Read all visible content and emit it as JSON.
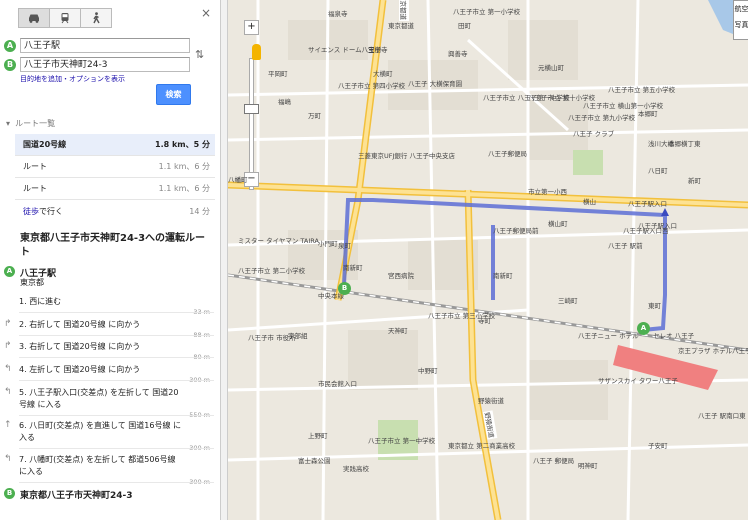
{
  "modes": [
    {
      "icon": "car-icon"
    },
    {
      "icon": "train-icon"
    },
    {
      "icon": "walk-icon"
    }
  ],
  "close": "×",
  "waypoints": [
    {
      "marker": "A",
      "value": "八王子駅"
    },
    {
      "marker": "B",
      "value": "八王子市天神町24-3"
    }
  ],
  "options_link": "目的地を追加・オプションを表示",
  "search_button": "検索",
  "routes_header": "ルート一覧",
  "routes": [
    {
      "name": "国道20号線",
      "distance": "1.8 km、5 分",
      "selected": true
    },
    {
      "name": "ルート",
      "distance": "1.1 km、6 分"
    },
    {
      "name": "ルート",
      "distance": "1.1 km、6 分"
    },
    {
      "name_link": "徒歩",
      "name_rest": "で行く",
      "distance": "14 分"
    }
  ],
  "directions_title": "東京都八王子市天神町24-3への運転ルート",
  "start": {
    "marker": "A",
    "name": "八王子駅",
    "sub": "東京都"
  },
  "steps": [
    {
      "num": "1.",
      "text": "西に進む",
      "dist": "33 m"
    },
    {
      "num": "2.",
      "text": "右折して 国道20号線 に向かう",
      "dist": "88 m"
    },
    {
      "num": "3.",
      "text": "右折して 国道20号線 に向かう",
      "dist": "80 m"
    },
    {
      "num": "4.",
      "text": "左折して 国道20号線 に向かう",
      "dist": "300 m"
    },
    {
      "num": "5.",
      "text": "八王子駅入口(交差点) を左折して 国道20号線 に入る",
      "dist": "550 m"
    },
    {
      "num": "6.",
      "text": "八日町(交差点) を直進して 国道16号線 に入る",
      "dist": "300 m"
    },
    {
      "num": "7.",
      "text": "八幡町(交差点) を左折して 都道506号線 に入る",
      "dist": "300 m"
    }
  ],
  "end": {
    "marker": "B",
    "name": "東京都八王子市天神町24-3"
  },
  "map": {
    "zoom_plus": "+",
    "zoom_minus": "−",
    "map_type": "航空写真",
    "labels": [
      "福泉寺",
      "八王子市立 第一小学校",
      "東京都道",
      "田町",
      "サイエンス ドーム八王子",
      "宝樹寺",
      "興善寺",
      "大横町",
      "平岡町",
      "八王子市立 第四小学校",
      "八王子 大横保育園",
      "福嶋",
      "八王子市立 八王子第一中学校",
      "八王子市立 第十小学校",
      "万町",
      "元横山町",
      "八王子市立 第五小学校",
      "八王子市立 横山第一小学校",
      "八王子市立 第九小学校",
      "本郷町",
      "八王子 クラブ",
      "本郷横丁東",
      "八幡町",
      "三菱東京UFJ銀行 八王子中央支店",
      "八王子郵便局",
      "八日町",
      "新町",
      "浅川大橋",
      "横山",
      "市立第一小西",
      "ミスター タイヤマン TAIRA",
      "八王子市立 第二小学校",
      "泉町",
      "小門町",
      "南新町",
      "三崎町",
      "横山町",
      "八王子駅入口",
      "八王子駅入口西",
      "八王子郵便局前",
      "宮西病院",
      "八王子 駅前",
      "東町",
      "中央本線",
      "セレオ 八王子",
      "京王プラザ ホテル八王子",
      "八王子ニュー ホテル",
      "サザンスカイ タワー八王子",
      "八王子市立 第三小学校",
      "天神町",
      "子安町",
      "上野町",
      "富士森公園",
      "実践高校",
      "東京都立 第二商業高校",
      "八王子 郵便局",
      "市民会館入口",
      "野猿街道",
      "八王子駅入口",
      "八王子市 市役所",
      "南新町",
      "寺町",
      "宇部組",
      "中野町",
      "八王子市立 第一中学校",
      "明神町",
      "八王子 駅南口東"
    ]
  },
  "road_labels": {
    "koshu": "甲州街道",
    "yaen": "野猿街道"
  }
}
